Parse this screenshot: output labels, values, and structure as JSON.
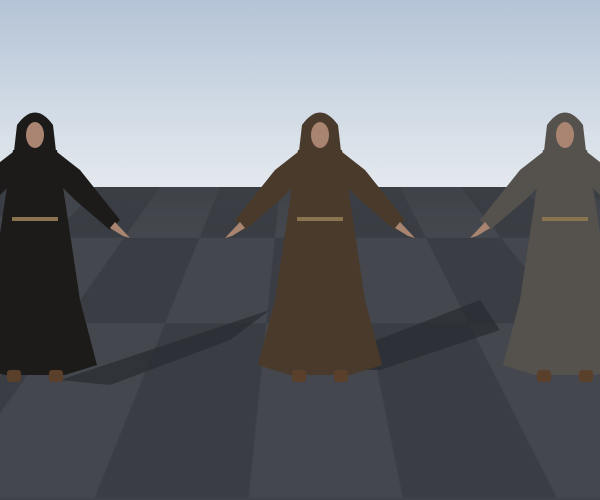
{
  "scene": {
    "sky_color": "#d6dee7",
    "floor_colors": [
      "#3a3e44",
      "#44484e"
    ],
    "figures": [
      {
        "name": "black-robed-monk",
        "robe_color": "#1c1b1a"
      },
      {
        "name": "brown-robed-monk",
        "robe_color": "#4a3a2c"
      },
      {
        "name": "gray-robed-monk",
        "robe_color": "#55524d"
      }
    ],
    "skin_color": "#a98470",
    "belt_color": "#8a7450"
  }
}
